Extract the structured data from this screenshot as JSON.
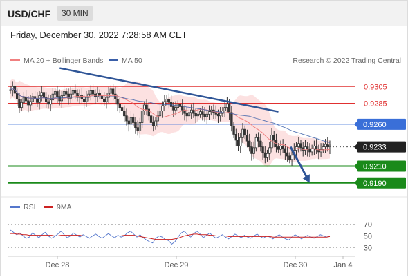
{
  "header": {
    "symbol": "USD/CHF",
    "interval": "30 MIN",
    "datetime": "Friday, December 30, 2022 7:28:58 AM CET"
  },
  "legend": {
    "ma20_label": "MA 20 + Bollinger Bands",
    "ma50_label": "MA 50",
    "copyright": "Research © 2022 Trading Central",
    "rsi_label": "RSI",
    "rsi_ma_label": "9MA"
  },
  "colors": {
    "ma20": "#f08080",
    "ma50": "#3a5fa8",
    "bollinger_fill": "#fbdcdc",
    "resistance": "#e03030",
    "pivot": "#3a6fd8",
    "support": "#1a8a1a",
    "current": "#222222",
    "trendline": "#2f5597",
    "rsi": "#5577cc",
    "rsi_ma": "#cc2222"
  },
  "chart_data": [
    {
      "type": "candlestick",
      "ylim": [
        0.9175,
        0.9325
      ],
      "levels": [
        {
          "value": 0.9305,
          "label": "0.9305",
          "kind": "resistance"
        },
        {
          "value": 0.9285,
          "label": "0.9285",
          "kind": "resistance"
        },
        {
          "value": 0.926,
          "label": "0.9260",
          "kind": "pivot"
        },
        {
          "value": 0.9233,
          "label": "0.9233",
          "kind": "current"
        },
        {
          "value": 0.921,
          "label": "0.9210",
          "kind": "support"
        },
        {
          "value": 0.919,
          "label": "0.9190",
          "kind": "support"
        }
      ],
      "x_ticks": [
        "Dec 28",
        "Dec 29",
        "Dec 30",
        "Jan 4"
      ],
      "trendline": {
        "from": [
          0.15,
          0.9327
        ],
        "to": [
          0.78,
          0.9275
        ]
      },
      "projection_arrow": {
        "from": [
          0.815,
          0.9233
        ],
        "to": [
          0.87,
          0.919
        ]
      },
      "closes": [
        0.9301,
        0.9305,
        0.9297,
        0.929,
        0.928,
        0.9286,
        0.9292,
        0.9288,
        0.9283,
        0.9287,
        0.9293,
        0.929,
        0.9286,
        0.9294,
        0.9298,
        0.9292,
        0.9287,
        0.9284,
        0.9289,
        0.9296,
        0.9299,
        0.9293,
        0.9288,
        0.9294,
        0.9299,
        0.9296,
        0.9291,
        0.9296,
        0.93,
        0.9297,
        0.9292,
        0.9295,
        0.929,
        0.9287,
        0.9292,
        0.9296,
        0.93,
        0.9296,
        0.9293,
        0.9297,
        0.9294,
        0.929,
        0.9287,
        0.9292,
        0.9297,
        0.9302,
        0.9296,
        0.929,
        0.9284,
        0.928,
        0.9276,
        0.927,
        0.9264,
        0.926,
        0.9268,
        0.9262,
        0.9256,
        0.9252,
        0.9262,
        0.9276,
        0.9283,
        0.9278,
        0.927,
        0.9262,
        0.9258,
        0.9264,
        0.927,
        0.9276,
        0.9282,
        0.9287,
        0.929,
        0.9286,
        0.9281,
        0.9277,
        0.928,
        0.9284,
        0.9281,
        0.9277,
        0.9273,
        0.927,
        0.9274,
        0.9277,
        0.9273,
        0.927,
        0.9272,
        0.9275,
        0.9272,
        0.9269,
        0.9272,
        0.9275,
        0.9277,
        0.9274,
        0.9272,
        0.927,
        0.9273,
        0.9276,
        0.928,
        0.9284,
        0.9274,
        0.9258,
        0.9248,
        0.9241,
        0.9234,
        0.9244,
        0.9254,
        0.9247,
        0.924,
        0.9233,
        0.9225,
        0.9232,
        0.9244,
        0.924,
        0.9233,
        0.9226,
        0.922,
        0.9225,
        0.9232,
        0.9247,
        0.9241,
        0.9233,
        0.923,
        0.9234,
        0.9231,
        0.9226,
        0.9222,
        0.9218,
        0.9223,
        0.9229,
        0.9233,
        0.9237,
        0.9232,
        0.9229,
        0.9233,
        0.923,
        0.9227,
        0.9231,
        0.9234,
        0.923,
        0.9227,
        0.923,
        0.9233,
        0.9236,
        0.9233,
        0.9235
      ]
    },
    {
      "type": "line",
      "title": "RSI",
      "ylim": [
        20,
        80
      ],
      "y_ticks": [
        70,
        50,
        30
      ],
      "series": [
        {
          "name": "RSI",
          "values": [
            60,
            56,
            52,
            55,
            50,
            46,
            48,
            55,
            51,
            47,
            52,
            56,
            50,
            46,
            49,
            53,
            58,
            52,
            47,
            50,
            55,
            51,
            48,
            52,
            49,
            46,
            50,
            53,
            49,
            46,
            50,
            54,
            50,
            47,
            51,
            48,
            50,
            55,
            58,
            53,
            48,
            52,
            47,
            43,
            40,
            38,
            46,
            50,
            48,
            44,
            42,
            36,
            40,
            48,
            55,
            58,
            52,
            48,
            54,
            58,
            53,
            47,
            51,
            55,
            50,
            46,
            49,
            52,
            48,
            45,
            49,
            53,
            50,
            47,
            51,
            48,
            46,
            50,
            53,
            49,
            46,
            50,
            48,
            45,
            49,
            52,
            48,
            45,
            43,
            48,
            52,
            49,
            45,
            48,
            51,
            48,
            46,
            49,
            52,
            50,
            48,
            50
          ]
        },
        {
          "name": "9MA",
          "values": [
            54,
            54,
            53,
            53,
            52,
            52,
            51,
            51,
            51,
            51,
            51,
            51,
            51,
            51,
            50,
            50,
            51,
            51,
            51,
            51,
            51,
            51,
            51,
            50,
            50,
            50,
            50,
            50,
            50,
            50,
            50,
            50,
            50,
            50,
            50,
            50,
            51,
            51,
            51,
            51,
            50,
            49,
            48,
            47,
            46,
            45,
            44,
            44,
            44,
            44,
            44,
            44,
            45,
            46,
            48,
            50,
            51,
            52,
            53,
            53,
            52,
            52,
            52,
            51,
            51,
            50,
            50,
            50,
            50,
            49,
            49,
            49,
            49,
            49,
            49,
            49,
            49,
            49,
            49,
            49,
            49,
            49,
            49,
            48,
            48,
            48,
            48,
            48,
            48,
            48,
            48,
            48,
            48,
            48,
            48,
            48,
            48,
            48,
            48,
            48,
            48,
            49
          ]
        }
      ]
    }
  ]
}
